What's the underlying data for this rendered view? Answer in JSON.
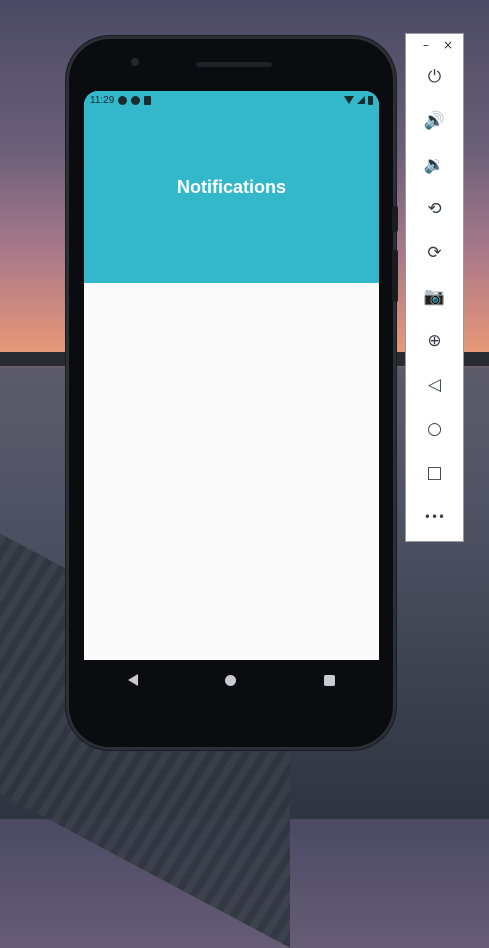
{
  "app": {
    "status_bar": {
      "time": "11:29",
      "icons": [
        "a-circle-icon",
        "half-circle-icon",
        "sd-card-icon"
      ],
      "right_icons": [
        "wifi-icon",
        "signal-icon",
        "battery-icon"
      ]
    },
    "header": {
      "title": "Notifications",
      "color": "#33b8cb"
    },
    "nav_bar": [
      "back-icon",
      "home-icon",
      "recents-icon"
    ]
  },
  "emulator_toolbar": {
    "window_controls": {
      "minimize": "–",
      "close": "×"
    },
    "buttons": [
      {
        "name": "power-icon",
        "glyph": "⏻"
      },
      {
        "name": "volume-up-icon",
        "glyph": "🔊"
      },
      {
        "name": "volume-down-icon",
        "glyph": "🔉"
      },
      {
        "name": "rotate-left-icon",
        "glyph": "⟲"
      },
      {
        "name": "rotate-right-icon",
        "glyph": "⟳"
      },
      {
        "name": "camera-icon",
        "glyph": "📷"
      },
      {
        "name": "zoom-icon",
        "glyph": "⊕"
      },
      {
        "name": "back-icon",
        "glyph": "◁"
      },
      {
        "name": "home-icon",
        "glyph": "○"
      },
      {
        "name": "overview-icon",
        "glyph": "□"
      },
      {
        "name": "more-icon",
        "glyph": "•••"
      }
    ]
  }
}
